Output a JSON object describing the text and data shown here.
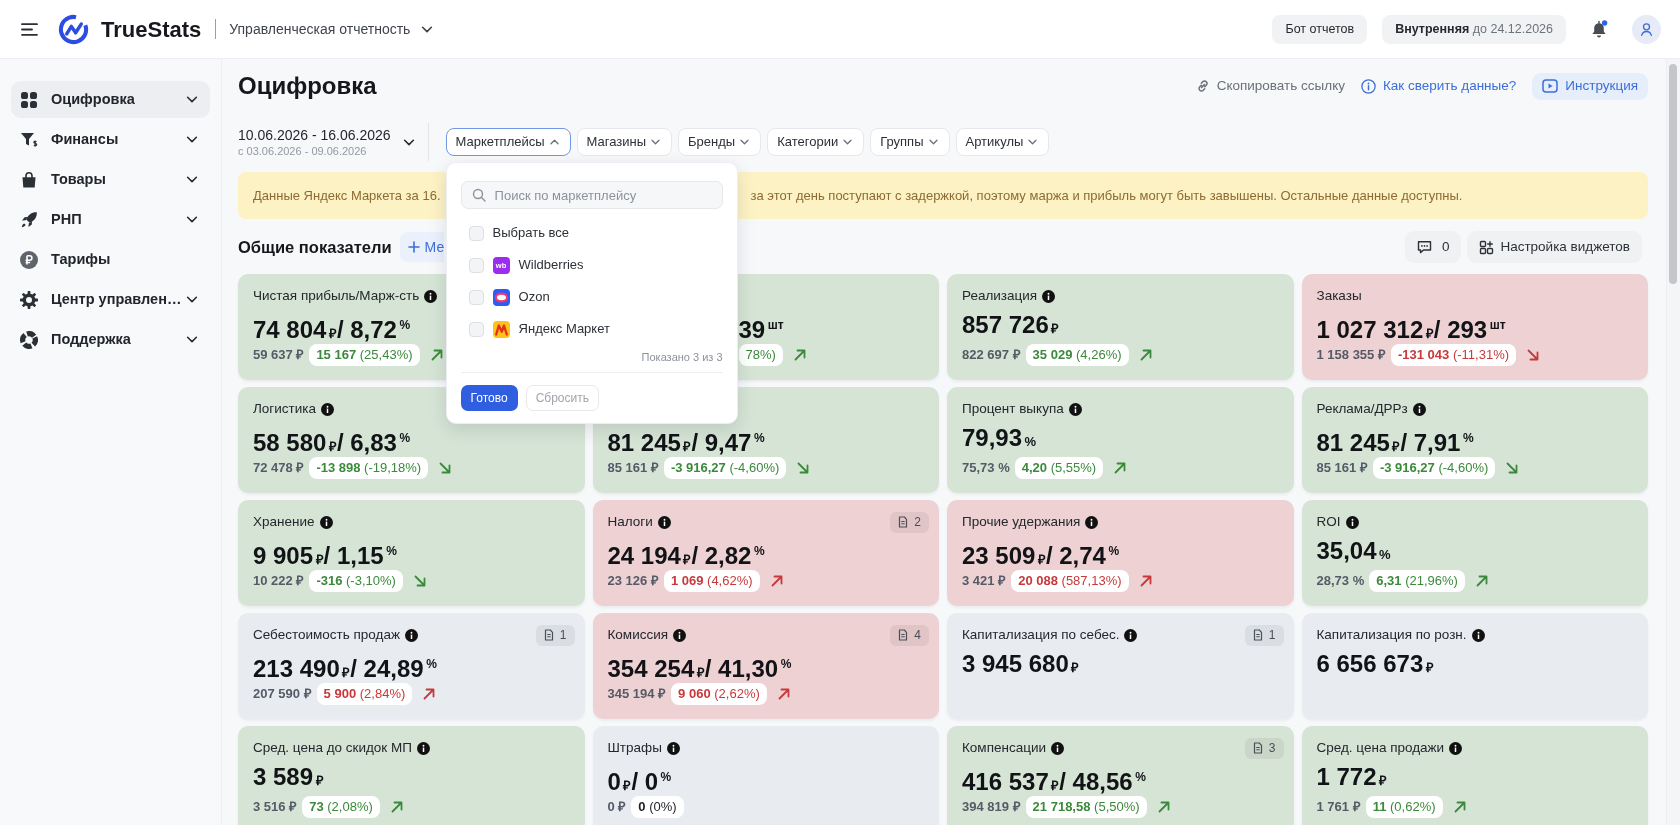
{
  "header": {
    "brand": "TrueStats",
    "report": "Управленческая отчетность",
    "bot_button": "Бот отчетов",
    "plan": {
      "name": "Внутренняя",
      "until": "до 24.12.2026"
    },
    "notifications_unread": true
  },
  "sidebar": {
    "items": [
      {
        "label": "Оцифровка",
        "selected": true,
        "submenu": true
      },
      {
        "label": "Финансы",
        "selected": false,
        "submenu": true
      },
      {
        "label": "Товары",
        "selected": false,
        "submenu": true
      },
      {
        "label": "РНП",
        "selected": false,
        "submenu": true
      },
      {
        "label": "Тарифы",
        "selected": false,
        "submenu": false
      },
      {
        "label": "Центр управлен…",
        "selected": false,
        "submenu": true
      },
      {
        "label": "Поддержка",
        "selected": false,
        "submenu": true
      }
    ]
  },
  "page": {
    "title": "Оцифровка",
    "actions": [
      {
        "label": "Скопировать ссылку",
        "kind": "copy"
      },
      {
        "label": "Как сверить данные?",
        "kind": "help"
      },
      {
        "label": "Инструкция",
        "kind": "video"
      }
    ]
  },
  "period": {
    "range": "10.06.2026 - 16.06.2026",
    "compare": "с 03.06.2026 - 09.06.2026"
  },
  "filters": [
    {
      "label": "Маркетплейсы",
      "expanded": true,
      "menu": {
        "placeholder": "Поиск по маркетплейсу",
        "options": [
          {
            "label": "Выбрать все",
            "checked": false
          },
          {
            "label": "Wildberries",
            "checked": false,
            "logo": {
              "kind": "text",
              "text": "wb",
              "color": "#9b2cf0"
            }
          },
          {
            "label": "Ozon",
            "checked": false,
            "logo": {
              "kind": "ring",
              "color": "#2c5cf6"
            }
          },
          {
            "label": "Яндекс Маркет",
            "checked": false,
            "logo": {
              "kind": "zigzag",
              "color": "#ffc21a"
            }
          }
        ],
        "count": "Показано 3 из 3",
        "buttons": [
          {
            "label": "Готово",
            "kind": "primary",
            "disabled": false
          },
          {
            "label": "Сбросить",
            "kind": "secondary",
            "disabled": true
          }
        ]
      }
    },
    {
      "label": "Магазины",
      "expanded": false
    },
    {
      "label": "Бренды",
      "expanded": false
    },
    {
      "label": "Категории",
      "expanded": false
    },
    {
      "label": "Группы",
      "expanded": false
    },
    {
      "label": "Артикулы",
      "expanded": false
    }
  ],
  "banner": {
    "text_left": "Данные Яндекс Маркета за 16.",
    "text_right": "за этот день поступают с задержкой, поэтому маржа и прибыль могут быть завышены. Остальные данные доступны."
  },
  "section": {
    "title": "Общие показатели",
    "add_button": "Ме",
    "comments": "0",
    "widgets_button": "Настройка виджетов"
  },
  "cards": [
    {
      "title": "Чистая прибыль/Марж-сть",
      "info": true,
      "color": "#d6e4d5",
      "value": {
        "amount": "74 804",
        "unit": "₽",
        "ratio": "/ 8,72",
        "ratio_unit": "%"
      },
      "comparison": {
        "previous": "59 637 ₽",
        "delta": "15 167",
        "percent": "(25,43%)",
        "rising": true,
        "color": "#3b8a3b"
      }
    },
    {
      "color": "#d6e4d5",
      "value": {
        "ratio": "39",
        "ratio_unit": "шт"
      },
      "comparison": {
        "percent": "78%)",
        "rising": true,
        "color": "#3b8a3b"
      }
    },
    {
      "title": "Реализация",
      "info": true,
      "color": "#d6e4d5",
      "value": {
        "amount": "857 726",
        "unit": "₽"
      },
      "comparison": {
        "previous": "822 697 ₽",
        "delta": "35 029",
        "percent": "(4,26%)",
        "rising": true,
        "color": "#3b8a3b"
      }
    },
    {
      "title": "Заказы",
      "info": false,
      "color": "#eed1d3",
      "value": {
        "amount": "1 027 312",
        "unit": "₽",
        "ratio": "/ 293",
        "ratio_unit": "шт"
      },
      "comparison": {
        "previous": "1 158 355 ₽",
        "delta": "-131 043",
        "percent": "(-11,31%)",
        "rising": false,
        "color": "#c8393b"
      }
    },
    {
      "title": "Логистика",
      "info": true,
      "color": "#d6e4d5",
      "value": {
        "amount": "58 580",
        "unit": "₽",
        "ratio": "/ 6,83",
        "ratio_unit": "%"
      },
      "comparison": {
        "previous": "72 478 ₽",
        "delta": "-13 898",
        "percent": "(-19,18%)",
        "rising": false,
        "color": "#3b8a3b"
      }
    },
    {
      "color": "#d6e4d5",
      "value": {
        "amount": "81 245",
        "unit": "₽",
        "ratio": "/ 9,47",
        "ratio_unit": "%"
      },
      "comparison": {
        "previous": "85 161 ₽",
        "delta": "-3 916,27",
        "percent": "(-4,60%)",
        "rising": false,
        "color": "#3b8a3b"
      }
    },
    {
      "title": "Процент выкупа",
      "info": true,
      "color": "#d6e4d5",
      "value": {
        "amount": "79,93",
        "unit": "%"
      },
      "comparison": {
        "previous": "75,73 %",
        "delta": "4,20",
        "percent": "(5,55%)",
        "rising": true,
        "color": "#3b8a3b"
      }
    },
    {
      "title": "Реклама/ДРРз",
      "info": true,
      "color": "#d6e4d5",
      "value": {
        "amount": "81 245",
        "unit": "₽",
        "ratio": "/ 7,91",
        "ratio_unit": "%"
      },
      "comparison": {
        "previous": "85 161 ₽",
        "delta": "-3 916,27",
        "percent": "(-4,60%)",
        "rising": false,
        "color": "#3b8a3b"
      }
    },
    {
      "title": "Хранение",
      "info": true,
      "color": "#d6e4d5",
      "value": {
        "amount": "9 905",
        "unit": "₽",
        "ratio": "/ 1,15",
        "ratio_unit": "%"
      },
      "comparison": {
        "previous": "10 222 ₽",
        "delta": "-316",
        "percent": "(-3,10%)",
        "rising": false,
        "color": "#3b8a3b"
      }
    },
    {
      "title": "Налоги",
      "info": true,
      "attachments": "2",
      "color": "#eed1d3",
      "value": {
        "amount": "24 194",
        "unit": "₽",
        "ratio": "/ 2,82",
        "ratio_unit": "%"
      },
      "comparison": {
        "previous": "23 126 ₽",
        "delta": "1 069",
        "percent": "(4,62%)",
        "rising": true,
        "color": "#c8393b"
      }
    },
    {
      "title": "Прочие удержания",
      "info": true,
      "color": "#eed1d3",
      "value": {
        "amount": "23 509",
        "unit": "₽",
        "ratio": "/ 2,74",
        "ratio_unit": "%"
      },
      "comparison": {
        "previous": "3 421 ₽",
        "delta": "20 088",
        "percent": "(587,13%)",
        "rising": true,
        "color": "#c8393b"
      }
    },
    {
      "title": "ROI",
      "info": true,
      "color": "#d6e4d5",
      "value": {
        "amount": "35,04",
        "unit": "%"
      },
      "comparison": {
        "previous": "28,73 %",
        "delta": "6,31",
        "percent": "(21,96%)",
        "rising": true,
        "color": "#3b8a3b"
      }
    },
    {
      "title": "Себестоимость продаж",
      "info": true,
      "attachments": "1",
      "color": "#e8ecf1",
      "value": {
        "amount": "213 490",
        "unit": "₽",
        "ratio": "/ 24,89",
        "ratio_unit": "%"
      },
      "comparison": {
        "previous": "207 590 ₽",
        "delta": "5 900",
        "percent": "(2,84%)",
        "rising": true,
        "color": "#c8393b"
      }
    },
    {
      "title": "Комиссия",
      "info": true,
      "attachments": "4",
      "color": "#eed1d3",
      "value": {
        "amount": "354 254",
        "unit": "₽",
        "ratio": "/ 41,30",
        "ratio_unit": "%"
      },
      "comparison": {
        "previous": "345 194 ₽",
        "delta": "9 060",
        "percent": "(2,62%)",
        "rising": true,
        "color": "#c8393b"
      }
    },
    {
      "title": "Капитализация по себес.",
      "info": true,
      "attachments": "1",
      "color": "#e8ecf1",
      "value": {
        "amount": "3 945 680",
        "unit": "₽"
      }
    },
    {
      "title": "Капитализация по розн.",
      "info": true,
      "color": "#e8ecf1",
      "value": {
        "amount": "6 656 673",
        "unit": "₽"
      }
    },
    {
      "title": "Сред. цена до скидок МП",
      "info": true,
      "color": "#d6e4d5",
      "value": {
        "amount": "3 589",
        "unit": "₽"
      },
      "comparison": {
        "previous": "3 516 ₽",
        "delta": "73",
        "percent": "(2,08%)",
        "rising": true,
        "color": "#3b8a3b"
      }
    },
    {
      "title": "Штрафы",
      "info": true,
      "color": "#e8ecf1",
      "value": {
        "amount": "0",
        "unit": "₽",
        "ratio": "/ 0",
        "ratio_unit": "%"
      },
      "comparison": {
        "previous": "0 ₽",
        "delta": "0",
        "percent": "(0%)",
        "color": "#1d2026"
      }
    },
    {
      "title": "Компенсации",
      "info": true,
      "attachments": "3",
      "color": "#d6e4d5",
      "value": {
        "amount": "416 537",
        "unit": "₽",
        "ratio": "/ 48,56",
        "ratio_unit": "%"
      },
      "comparison": {
        "previous": "394 819 ₽",
        "delta": "21 718,58",
        "percent": "(5,50%)",
        "rising": true,
        "color": "#3b8a3b"
      }
    },
    {
      "title": "Сред. цена продажи",
      "info": true,
      "color": "#d6e4d5",
      "value": {
        "amount": "1 772",
        "unit": "₽"
      },
      "comparison": {
        "previous": "1 761 ₽",
        "delta": "11",
        "percent": "(0,62%)",
        "rising": true,
        "color": "#3b8a3b"
      }
    }
  ]
}
